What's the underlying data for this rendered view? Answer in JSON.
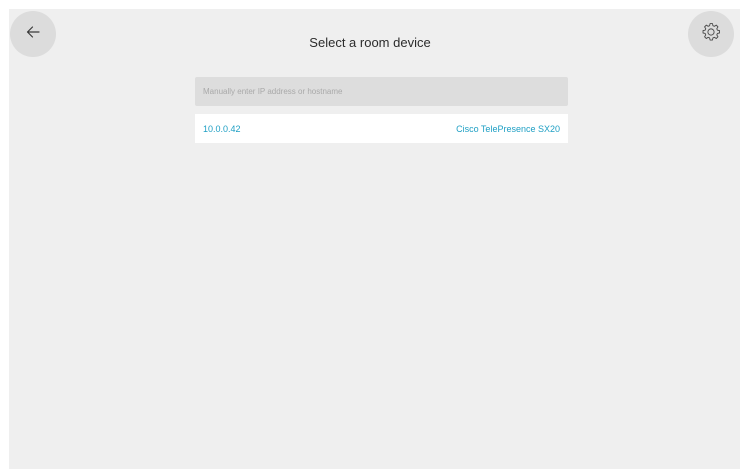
{
  "header": {
    "title": "Select a room device",
    "back_icon": "arrow-left-icon",
    "settings_icon": "gear-icon"
  },
  "search": {
    "value": "",
    "placeholder": "Manually enter IP address or hostname"
  },
  "devices": [
    {
      "ip": "10.0.0.42",
      "name": "Cisco TelePresence SX20"
    }
  ],
  "colors": {
    "background": "#efefef",
    "button": "#dcdcdc",
    "input": "#dddddd",
    "accent": "#1e9fc4",
    "text": "#2c2c2c"
  }
}
